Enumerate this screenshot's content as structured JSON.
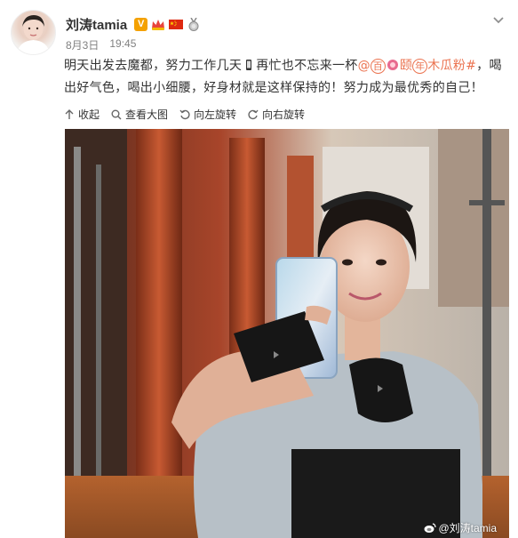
{
  "post": {
    "username": "刘涛tamia",
    "verified_badge": "V",
    "badges": [
      "crown-badge-icon",
      "china-flag-icon",
      "medal-icon"
    ],
    "date": "8月3日",
    "time": "19:45",
    "text_part1": "明天出发去魔都，努力工作几天",
    "text_part2": "再忙也不忘来一杯",
    "topic_at": "@",
    "topic_brand_1": "百",
    "topic_brand_2": "颐",
    "topic_brand_3": "年",
    "topic_tail": "木瓜粉#",
    "text_part3": "，喝出好气色，喝出小细腰，好身材就是这样保持的！努力成为最优秀的自己！"
  },
  "actions": {
    "collapse": "收起",
    "view_large": "查看大图",
    "rotate_left": "向左旋转",
    "rotate_right": "向右旋转"
  },
  "photo": {
    "watermark": "@刘涛tamia"
  },
  "colors": {
    "text": "#333333",
    "meta": "#808080",
    "topic": "#eb7350",
    "v_badge": "#f4a100"
  }
}
